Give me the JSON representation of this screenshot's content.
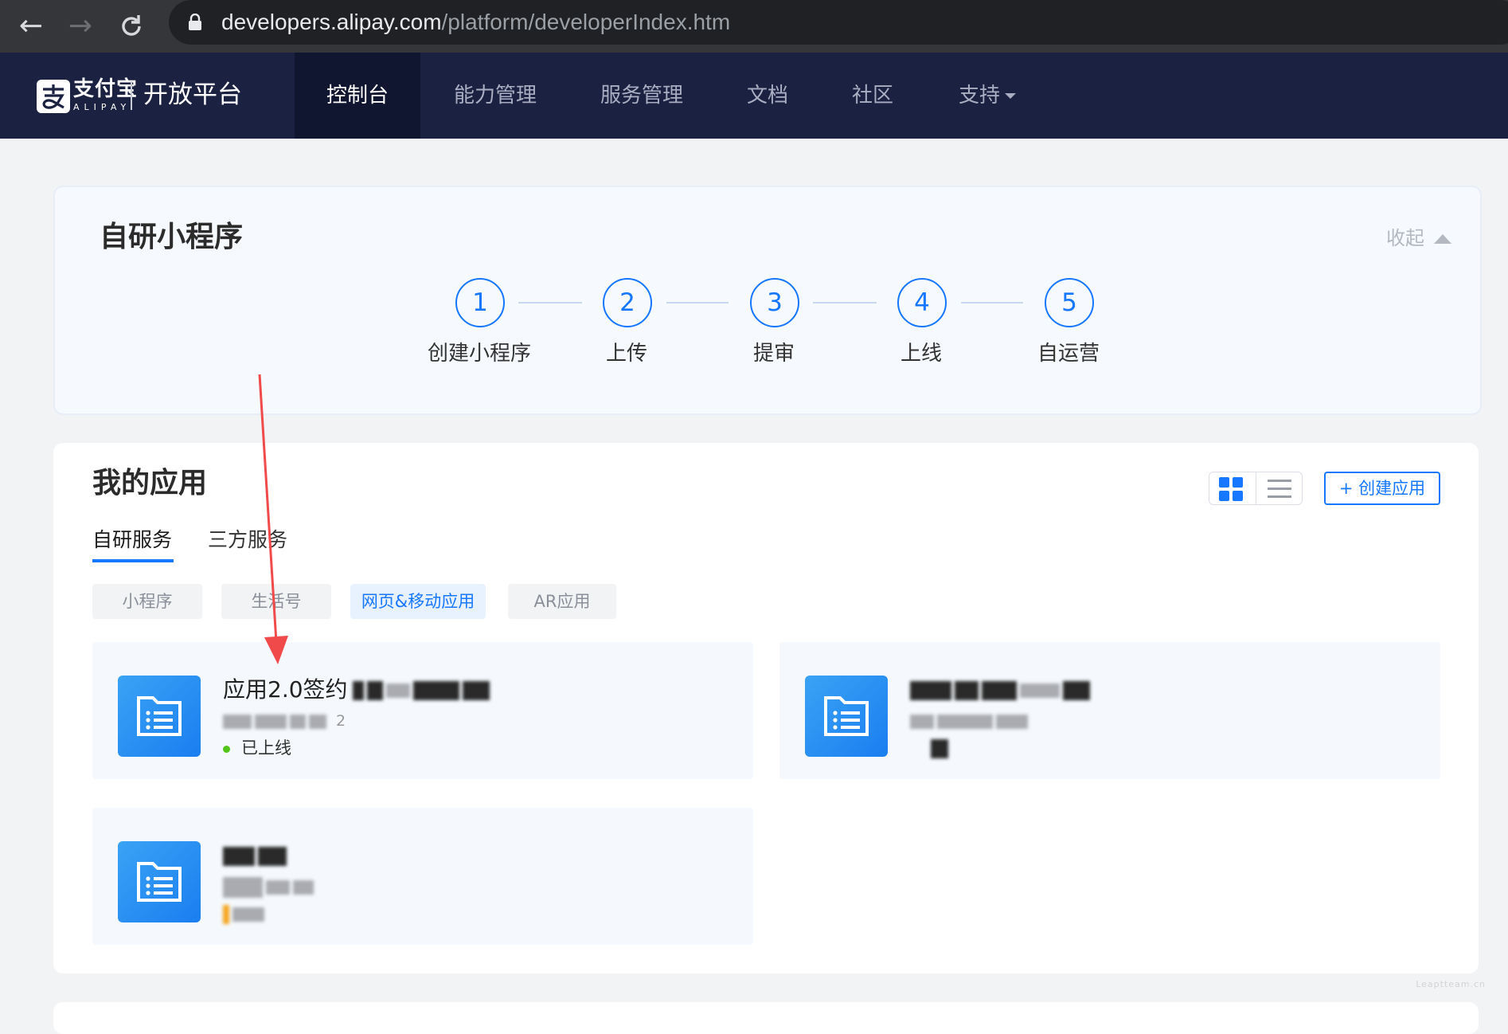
{
  "browser": {
    "url_host": "developers.alipay.com",
    "url_path": "/platform/developerIndex.htm"
  },
  "header": {
    "logo_brand": "支付宝",
    "logo_sub": "ALIPAY",
    "logo_platform": "开放平台",
    "nav": [
      "控制台",
      "能力管理",
      "服务管理",
      "文档",
      "社区",
      "支持"
    ],
    "active_nav": "控制台"
  },
  "steps_card": {
    "title": "自研小程序",
    "collapse_label": "收起",
    "steps": [
      {
        "num": "1",
        "label": "创建小程序"
      },
      {
        "num": "2",
        "label": "上传"
      },
      {
        "num": "3",
        "label": "提审"
      },
      {
        "num": "4",
        "label": "上线"
      },
      {
        "num": "5",
        "label": "自运营"
      }
    ]
  },
  "apps": {
    "title": "我的应用",
    "create_button": "+ 创建应用",
    "tabs": [
      "自研服务",
      "三方服务"
    ],
    "active_tab": "自研服务",
    "filters": [
      "小程序",
      "生活号",
      "网页&移动应用",
      "AR应用"
    ],
    "active_filter": "网页&移动应用",
    "cards": [
      {
        "name": "应用2.0签约",
        "id": "2",
        "status": "已上线",
        "status_color": "#52c41a"
      }
    ]
  },
  "watermark": "Leaptteam.cn",
  "colors": {
    "accent": "#1677ff",
    "header_bg": "#1b2140",
    "annotation_arrow": "#f04a4a"
  }
}
